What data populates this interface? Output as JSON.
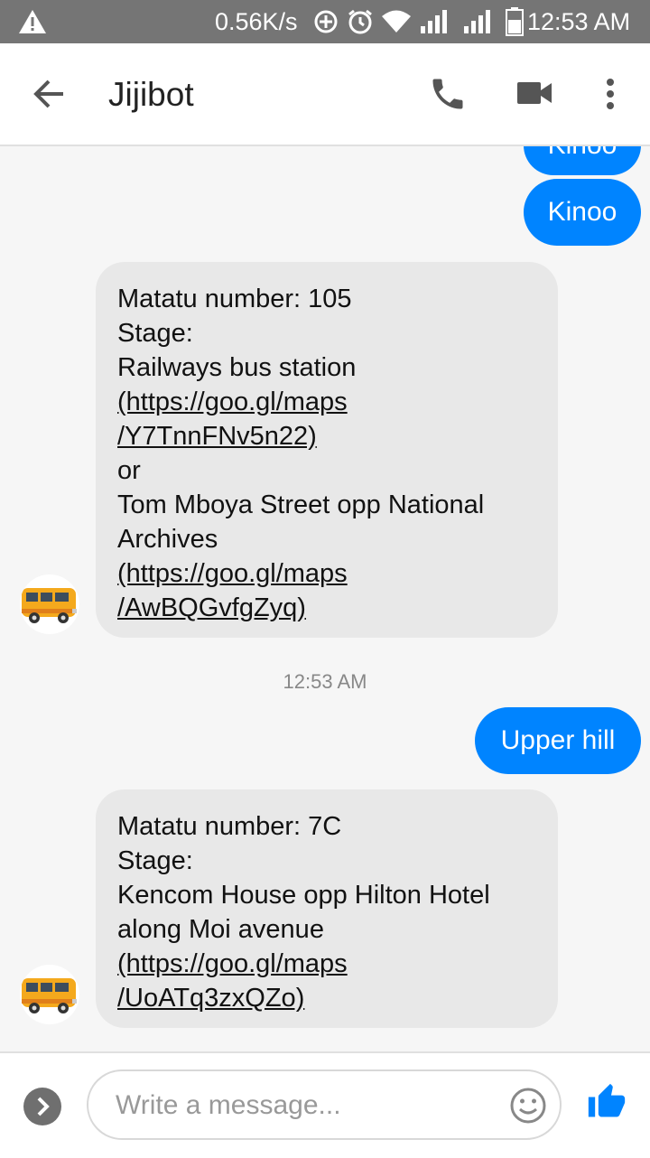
{
  "status_bar": {
    "speed": "0.56K/s",
    "time": "12:53 AM"
  },
  "header": {
    "title": "Jijibot"
  },
  "messages": {
    "out_partial": "Kinoo",
    "out_1": "Kinoo",
    "bot_1": {
      "lines": [
        "Matatu number: 105",
        "Stage:",
        "Railways bus station",
        "(https://goo.gl/maps",
        "/Y7TnnFNv5n22)",
        "or",
        "Tom Mboya Street opp National",
        "Archives",
        "(https://goo.gl/maps",
        "/AwBQGvfgZyq)"
      ]
    },
    "timestamp": "12:53 AM",
    "out_2": "Upper hill",
    "bot_2": {
      "lines": [
        "Matatu number: 7C",
        "Stage:",
        "Kencom House opp Hilton Hotel",
        "along Moi avenue",
        "(https://goo.gl/maps",
        "/UoATq3zxQZo)"
      ]
    }
  },
  "compose": {
    "placeholder": "Write a message..."
  },
  "colors": {
    "accent": "#0084ff",
    "bot_bubble": "#e8e8e8"
  }
}
